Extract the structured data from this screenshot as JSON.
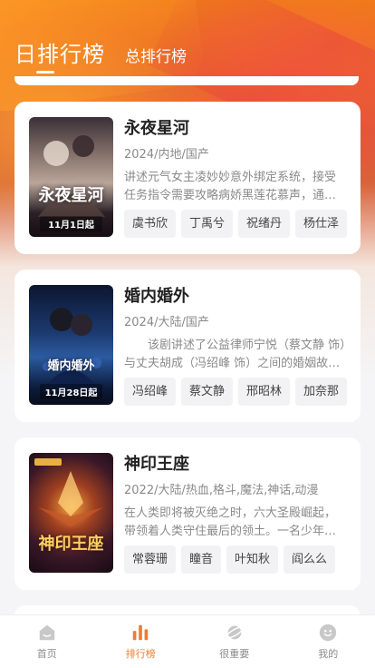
{
  "header": {
    "tab_day": "日排行榜",
    "tab_total": "总排行榜"
  },
  "items": [
    {
      "title": "永夜星河",
      "meta": "2024/内地/国产",
      "desc": "讲述元气女主凌妙妙意外绑定系统，接受任务指令需要攻略病娇黑莲花慕声，通过...",
      "actors": [
        "虞书欣",
        "丁禹兮",
        "祝绪丹",
        "杨仕泽"
      ],
      "poster_title": "永夜星河",
      "poster_date": "11月1日起",
      "poster_colors": [
        "#2b2430",
        "#c9b8a8",
        "#1a1418"
      ]
    },
    {
      "title": "婚内婚外",
      "meta": "2024/大陆/国产",
      "desc": "　　该剧讲述了公益律师宁悦（蔡文静 饰）与丈夫胡成（冯绍峰 饰）之间的婚姻故事...",
      "actors": [
        "冯绍峰",
        "蔡文静",
        "邢昭林",
        "加奈那"
      ],
      "poster_title": "婚内婚外",
      "poster_date": "11月28日起",
      "poster_colors": [
        "#0d1d3e",
        "#22437a",
        "#0a1430"
      ]
    },
    {
      "title": "神印王座",
      "meta": "2022/大陆/热血,格斗,魔法,神话,动漫",
      "desc": "在人类即将被灭绝之时，六大圣殿崛起，带领着人类守住最后的领土。一名少年，为...",
      "actors": [
        "常蓉珊",
        "瞳音",
        "叶知秋",
        "阎么么"
      ],
      "poster_title": "神印王座",
      "poster_date": "",
      "poster_colors": [
        "#3a1a2a",
        "#7a3a20",
        "#1a0c14"
      ]
    }
  ],
  "tabbar": [
    {
      "label": "首页",
      "icon": "home-icon",
      "active": false
    },
    {
      "label": "排行榜",
      "icon": "bar-chart-icon",
      "active": true
    },
    {
      "label": "很重要",
      "icon": "planet-icon",
      "active": false
    },
    {
      "label": "我的",
      "icon": "smile-face-icon",
      "active": false
    }
  ],
  "colors": {
    "accent": "#f07c2e",
    "inactive": "#c8c8c8"
  }
}
